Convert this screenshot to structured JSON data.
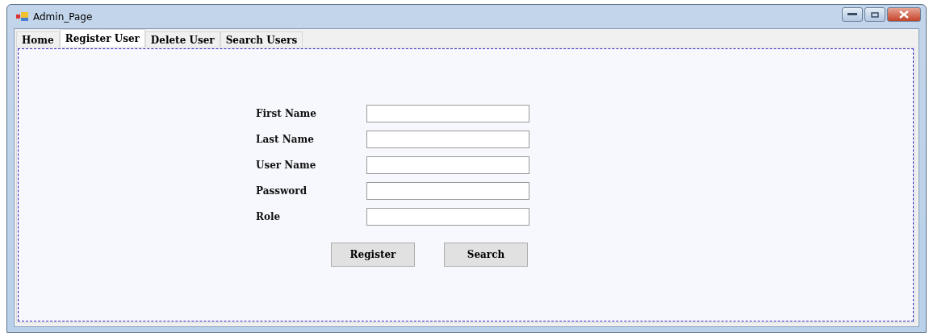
{
  "window": {
    "title": "Admin_Page"
  },
  "tabs": [
    {
      "label": "Home",
      "selected": false
    },
    {
      "label": "Register User",
      "selected": true
    },
    {
      "label": "Delete User",
      "selected": false
    },
    {
      "label": "Search Users",
      "selected": false
    }
  ],
  "form": {
    "fields": [
      {
        "label": "First Name"
      },
      {
        "label": "Last Name"
      },
      {
        "label": "User Name"
      },
      {
        "label": "Password"
      },
      {
        "label": "Role"
      }
    ],
    "buttons": [
      "Register",
      "Search"
    ]
  }
}
